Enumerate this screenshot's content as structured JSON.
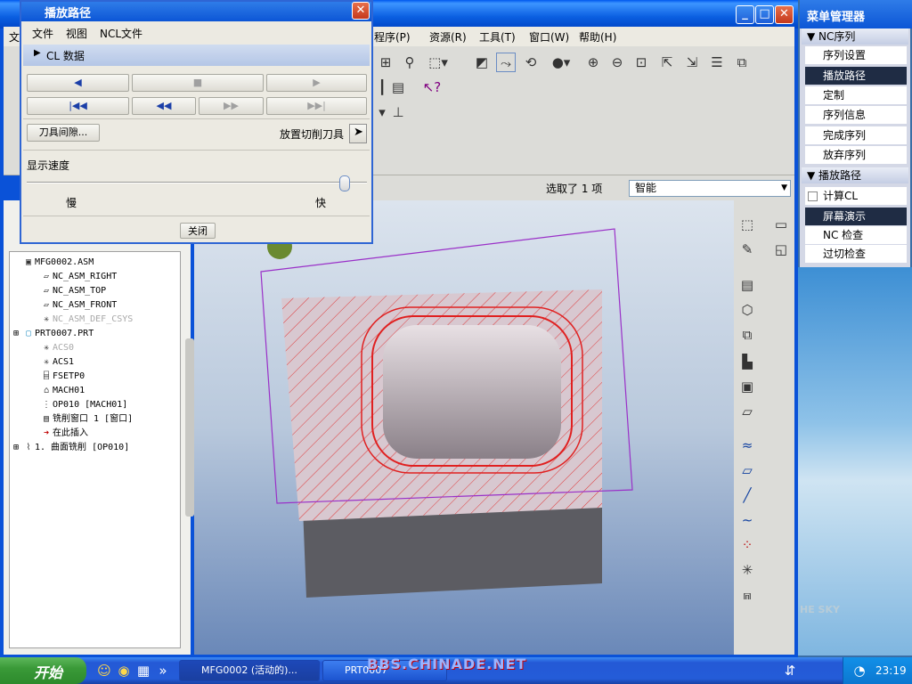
{
  "main": {
    "menus_visible": [
      "文",
      "程序(P)",
      "资源(R)",
      "工具(T)",
      "窗口(W)",
      "帮助(H)"
    ],
    "selection_status": "选取了 1 项",
    "filter_value": "智能"
  },
  "tree": {
    "nodes": [
      {
        "label": "MFG0002.ASM",
        "icon": "assembly-icon",
        "dim": false
      },
      {
        "label": "NC_ASM_RIGHT",
        "icon": "datum-plane-icon",
        "dim": false
      },
      {
        "label": "NC_ASM_TOP",
        "icon": "datum-plane-icon",
        "dim": false
      },
      {
        "label": "NC_ASM_FRONT",
        "icon": "datum-plane-icon",
        "dim": false
      },
      {
        "label": "NC_ASM_DEF_CSYS",
        "icon": "csys-icon",
        "dim": true
      },
      {
        "label": "PRT0007.PRT",
        "icon": "part-icon",
        "dim": false
      },
      {
        "label": "ACS0",
        "icon": "csys-icon",
        "dim": true
      },
      {
        "label": "ACS1",
        "icon": "csys-icon",
        "dim": false
      },
      {
        "label": "FSETP0",
        "icon": "fixture-icon",
        "dim": false
      },
      {
        "label": "MACH01",
        "icon": "machine-icon",
        "dim": false
      },
      {
        "label": "OP010 [MACH01]",
        "icon": "operation-icon",
        "dim": false
      },
      {
        "label": "铣削窗口 1 [窗口]",
        "icon": "mill-window-icon",
        "dim": false
      },
      {
        "label": "在此插入",
        "icon": "insert-here-icon",
        "dim": false
      },
      {
        "label": "1. 曲面铣削 [OP010]",
        "icon": "surface-mill-icon",
        "dim": false
      }
    ]
  },
  "dialog": {
    "title": "播放路径",
    "menus": [
      "文件",
      "视图",
      "NCL文件"
    ],
    "cl_data": "CL 数据",
    "tool_clearance": "刀具间隙...",
    "place_tool": "放置切削刀具",
    "display_speed": "显示速度",
    "slow": "慢",
    "fast": "快",
    "close": "关闭",
    "speed_level": 0.95
  },
  "menu_manager": {
    "title": "菜单管理器",
    "nc_sequence": "NC序列",
    "nc_items": [
      "序列设置",
      "播放路径",
      "定制",
      "序列信息",
      "完成序列",
      "放弃序列"
    ],
    "play_path": "播放路径",
    "play_items": [
      "计算CL",
      "屏幕演示",
      "NC 检查",
      "过切检查"
    ]
  },
  "taskbar": {
    "start": "开始",
    "tasks": [
      "MFG0002 (活动的)...",
      "PRT0007"
    ],
    "watermark": "BBS.CHINADE.NET",
    "clock": "23:19"
  },
  "desktop": {
    "wallpaper_text": "HE SKY"
  }
}
